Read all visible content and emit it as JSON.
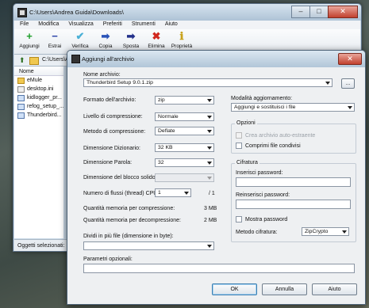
{
  "main_window": {
    "title": "C:\\Users\\Andrea Guida\\Downloads\\",
    "menu": [
      "File",
      "Modifica",
      "Visualizza",
      "Preferiti",
      "Strumenti",
      "Aiuto"
    ],
    "toolbar": [
      {
        "label": "Aggiungi",
        "icon": "add-icon",
        "glyph": "+",
        "color": "#1e9e2a"
      },
      {
        "label": "Estrai",
        "icon": "extract-icon",
        "glyph": "−",
        "color": "#2740a8"
      },
      {
        "label": "Verifica",
        "icon": "verify-icon",
        "glyph": "✔",
        "color": "#4ab0d6"
      },
      {
        "label": "Copia",
        "icon": "copy-icon",
        "glyph": "➡",
        "color": "#2a53b8"
      },
      {
        "label": "Sposta",
        "icon": "move-icon",
        "glyph": "➡",
        "color": "#22308a"
      },
      {
        "label": "Elimina",
        "icon": "delete-icon",
        "glyph": "✖",
        "color": "#d0271e"
      },
      {
        "label": "Proprietà",
        "icon": "info-icon",
        "glyph": "ℹ",
        "color": "#c8a21c"
      }
    ],
    "address": "C:\\Users\\Andrea Gu",
    "column_name": "Nome",
    "files": [
      {
        "name": "eMule",
        "type": "folder"
      },
      {
        "name": "desktop.ini",
        "type": "file"
      },
      {
        "name": "kidlogger_pr...",
        "type": "exe"
      },
      {
        "name": "refog_setup_...",
        "type": "exe"
      },
      {
        "name": "Thunderbird...",
        "type": "exe"
      }
    ],
    "status": "Oggetti selezionati: 1"
  },
  "dialog": {
    "title": "Aggiungi all'archivio",
    "archive_label": "Nome archivio:",
    "archive_value": "Thunderbird Setup 9.0.1.zip",
    "browse_label": "...",
    "format_label": "Formato dell'archivio:",
    "format_value": "zip",
    "level_label": "Livello di compressione:",
    "level_value": "Normale",
    "method_label": "Metodo di compressione:",
    "method_value": "Deflate",
    "dict_label": "Dimensione Dizionario:",
    "dict_value": "32 KB",
    "word_label": "Dimensione Parola:",
    "word_value": "32",
    "solid_label": "Dimensione del blocco solido:",
    "solid_value": "",
    "threads_label": "Numero di flussi (thread) CPU:",
    "threads_value": "1",
    "threads_total": "/ 1",
    "mem_comp_label": "Quantità memoria per compressione:",
    "mem_comp_value": "3 MB",
    "mem_decomp_label": "Quantità memoria per decompressione:",
    "mem_decomp_value": "2 MB",
    "split_label": "Dividi in più file (dimensione in byte):",
    "split_value": "",
    "update_label": "Modalità aggiornamento:",
    "update_value": "Aggiungi e sostituisci i file",
    "options_group": "Opzioni",
    "opt_sfx": "Crea archivio auto-estraente",
    "opt_shared": "Comprimi file condivisi",
    "encryption_group": "Cifratura",
    "password_label": "Inserisci password:",
    "password_repeat_label": "Reinserisci password:",
    "show_password": "Mostra password",
    "enc_method_label": "Metodo cifratura:",
    "enc_method_value": "ZipCrypto",
    "params_label": "Parametri opzionali:",
    "params_value": "",
    "ok": "OK",
    "cancel": "Annulla",
    "help": "Aiuto"
  }
}
